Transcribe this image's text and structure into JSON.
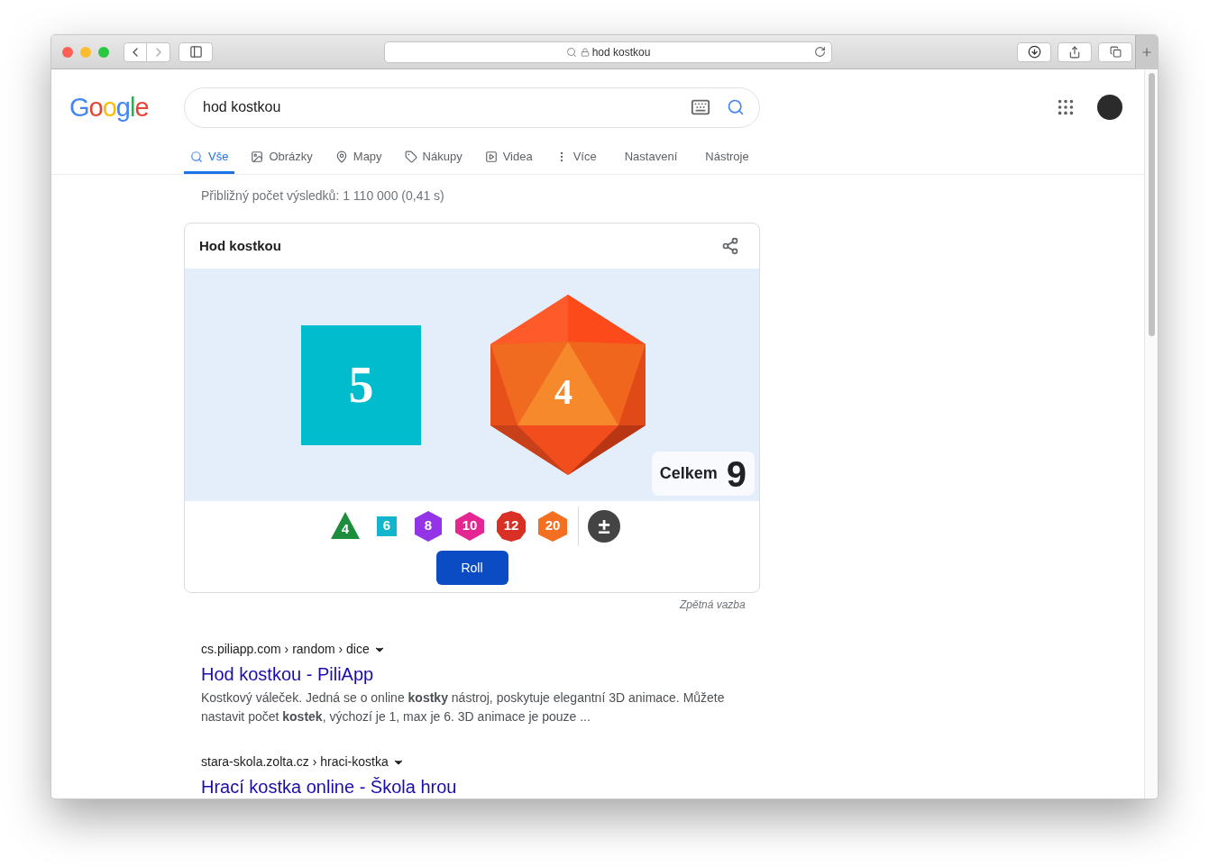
{
  "browser": {
    "address": "hod kostkou"
  },
  "logo": "Google",
  "search": {
    "value": "hod kostkou"
  },
  "tabs": [
    {
      "label": "Vše",
      "kind": "all",
      "selected": true
    },
    {
      "label": "Obrázky",
      "kind": "images",
      "selected": false
    },
    {
      "label": "Mapy",
      "kind": "maps",
      "selected": false
    },
    {
      "label": "Nákupy",
      "kind": "shopping",
      "selected": false
    },
    {
      "label": "Videa",
      "kind": "videos",
      "selected": false
    },
    {
      "label": "Více",
      "kind": "more",
      "selected": false
    },
    {
      "label": "Nastavení",
      "kind": "plain",
      "selected": false
    },
    {
      "label": "Nástroje",
      "kind": "plain",
      "selected": false
    }
  ],
  "result_stats": "Přibližný počet výsledků: 1 110 000 (0,41 s)",
  "dice_card": {
    "title": "Hod kostkou",
    "dice": [
      {
        "kind": "d6",
        "value": "5"
      },
      {
        "kind": "d20",
        "value": "4"
      }
    ],
    "total_label": "Celkem",
    "total": "9",
    "dice_types": [
      {
        "kind": "d4",
        "label": "4",
        "color": "#1e8e3e"
      },
      {
        "kind": "d6",
        "label": "6",
        "color": "#12b5cb"
      },
      {
        "kind": "d8",
        "label": "8",
        "color": "#9334e6"
      },
      {
        "kind": "d10",
        "label": "10",
        "color": "#e52592"
      },
      {
        "kind": "d12",
        "label": "12",
        "color": "#d93025"
      },
      {
        "kind": "d20",
        "label": "20",
        "color": "#f36f21"
      },
      {
        "kind": "modifier",
        "label": "±",
        "color": "#444444"
      }
    ],
    "roll_button": "Roll",
    "feedback": "Zpětná vazba"
  },
  "results": [
    {
      "url": "cs.piliapp.com › random › dice",
      "title": "Hod kostkou - PiliApp",
      "snippet": "Kostkový váleček. Jedná se o online **kostky** nástroj, poskytuje elegantní 3D animace. Můžete nastavit počet **kostek**, výchozí je 1, max je 6. 3D animace je pouze ..."
    },
    {
      "url": "stara-skola.zolta.cz › hraci-kostka",
      "title": "Hrací kostka online - Škola hrou"
    }
  ]
}
